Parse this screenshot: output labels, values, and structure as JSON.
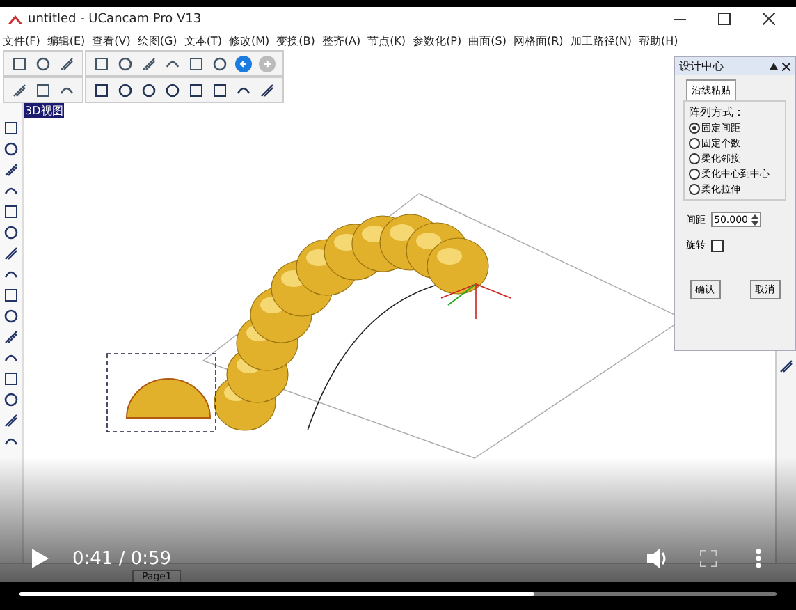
{
  "window": {
    "title": "untitled - UCancam Pro V13"
  },
  "menu": [
    "文件(F)",
    "编辑(E)",
    "查看(V)",
    "绘图(G)",
    "文本(T)",
    "修改(M)",
    "变换(B)",
    "整齐(A)",
    "节点(K)",
    "参数化(P)",
    "曲面(S)",
    "网格面(R)",
    "加工路径(N)",
    "帮助(H)"
  ],
  "viewport": {
    "label": "3D视图"
  },
  "panel": {
    "title": "设计中心",
    "tab": "沿线粘贴",
    "group": "阵列方式：",
    "options": [
      {
        "label": "固定间距",
        "selected": true
      },
      {
        "label": "固定个数",
        "selected": false
      },
      {
        "label": "柔化邻接",
        "selected": false
      },
      {
        "label": "柔化中心到中心",
        "selected": false
      },
      {
        "label": "柔化拉伸",
        "selected": false
      }
    ],
    "spacing": {
      "label": "间距",
      "value": "50.000"
    },
    "rotate": {
      "label": "旋转",
      "checked": false
    },
    "buttons": [
      "确认",
      "取消"
    ]
  },
  "page_tab": "Page1",
  "player": {
    "time": "0:41 / 0:59",
    "level": 0.68
  }
}
